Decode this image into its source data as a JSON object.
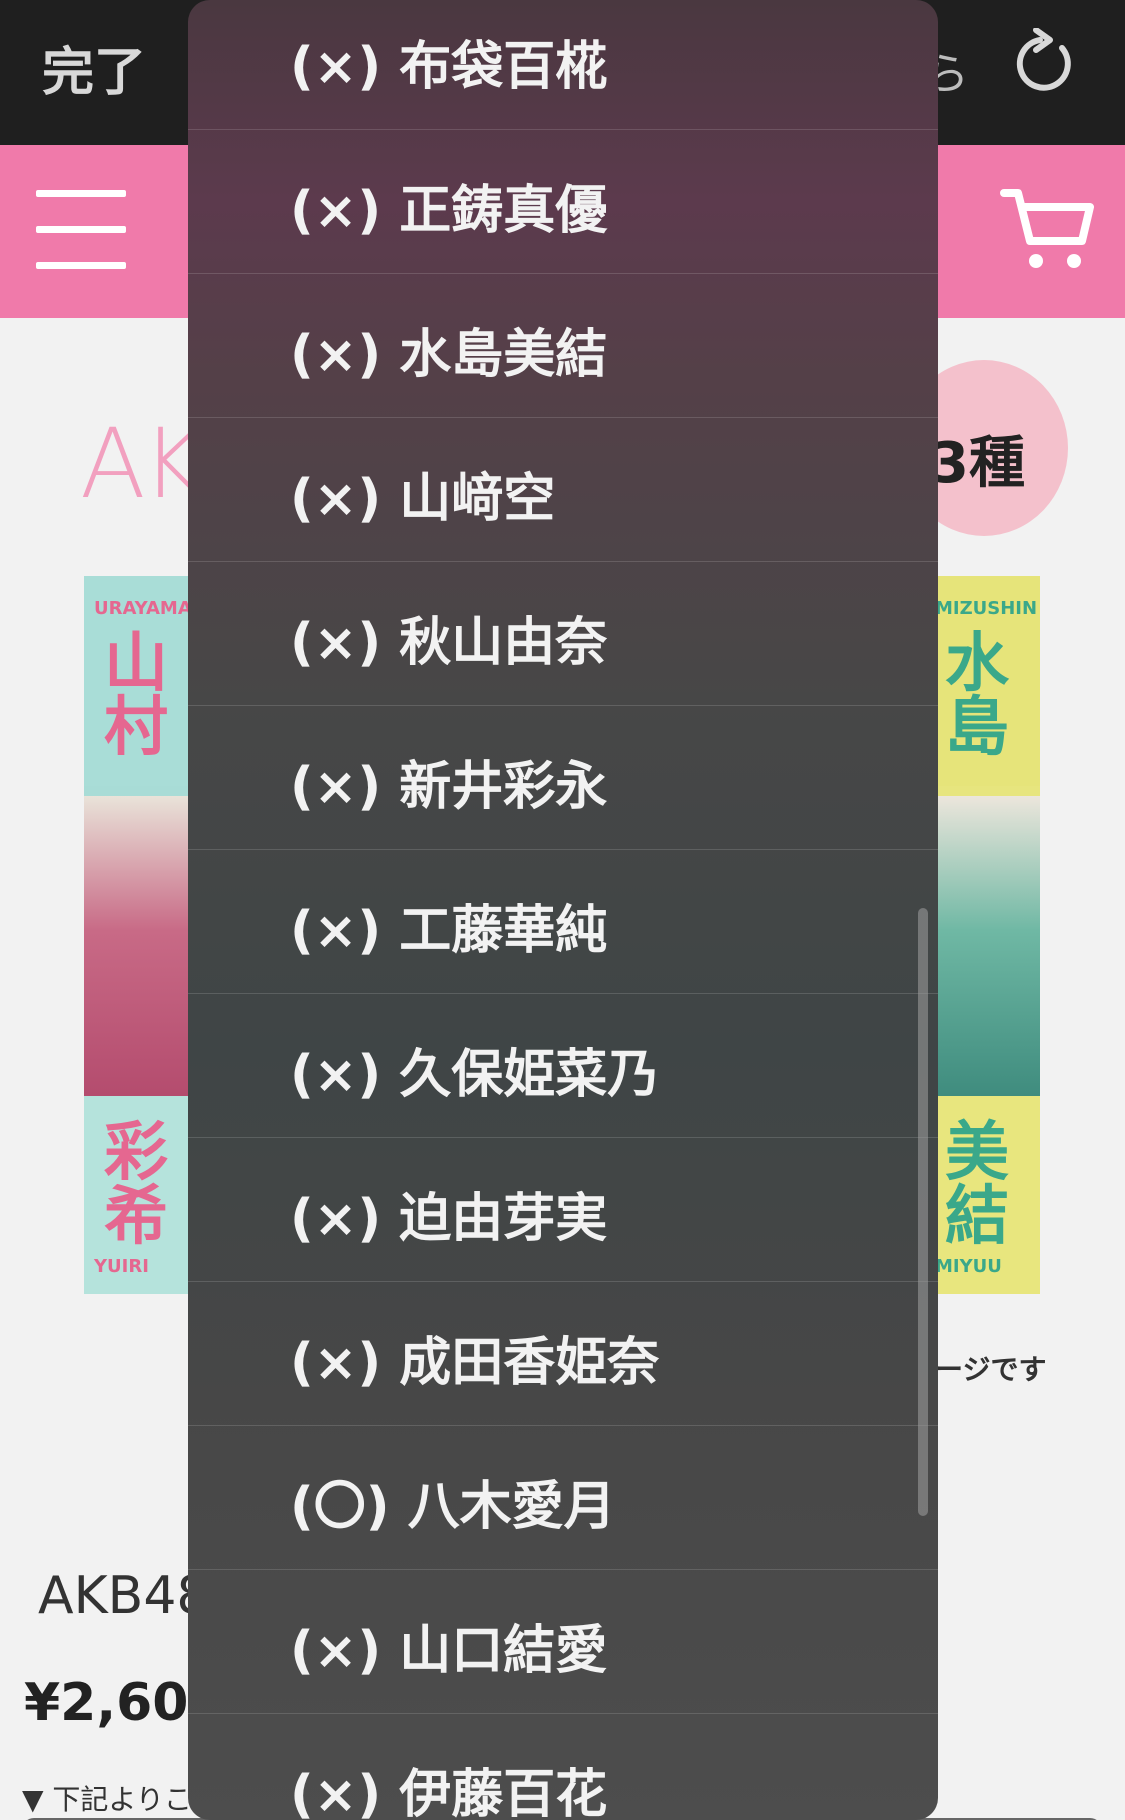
{
  "browser_bar": {
    "done_label": "完了",
    "partial_text": "ら",
    "reload_icon": "reload-icon"
  },
  "site_header": {
    "menu_icon": "hamburger-icon",
    "cart_icon": "cart-icon",
    "background": "#f07aaa"
  },
  "page": {
    "logo_text": "AK",
    "badge_text": "3種",
    "poster_left": {
      "romaji_top": "URAYAMA",
      "kanji_top": "山村",
      "kanji_bottom": "彩希",
      "romaji_bottom": "YUIRI"
    },
    "poster_right": {
      "romaji_top": "MIZUSHIN",
      "kanji_top": "水島",
      "kanji_bottom": "美結",
      "romaji_bottom": "MIYUU"
    },
    "note_partial": "ージです",
    "title_partial": "AKB48",
    "price_partial": "¥2,600",
    "hint_partial": "▼ 下記よりこ"
  },
  "dropdown": {
    "items": [
      {
        "label": "(×) 布袋百椛"
      },
      {
        "label": "(×) 正鋳真優"
      },
      {
        "label": "(×) 水島美結"
      },
      {
        "label": "(×) 山﨑空"
      },
      {
        "label": "(×) 秋山由奈"
      },
      {
        "label": "(×) 新井彩永"
      },
      {
        "label": "(×) 工藤華純"
      },
      {
        "label": "(×) 久保姫菜乃"
      },
      {
        "label": "(×) 迫由芽実"
      },
      {
        "label": "(×) 成田香姫奈"
      },
      {
        "label": "(〇) 八木愛月"
      },
      {
        "label": "(×) 山口結愛"
      },
      {
        "label": "(×) 伊藤百花"
      }
    ]
  }
}
